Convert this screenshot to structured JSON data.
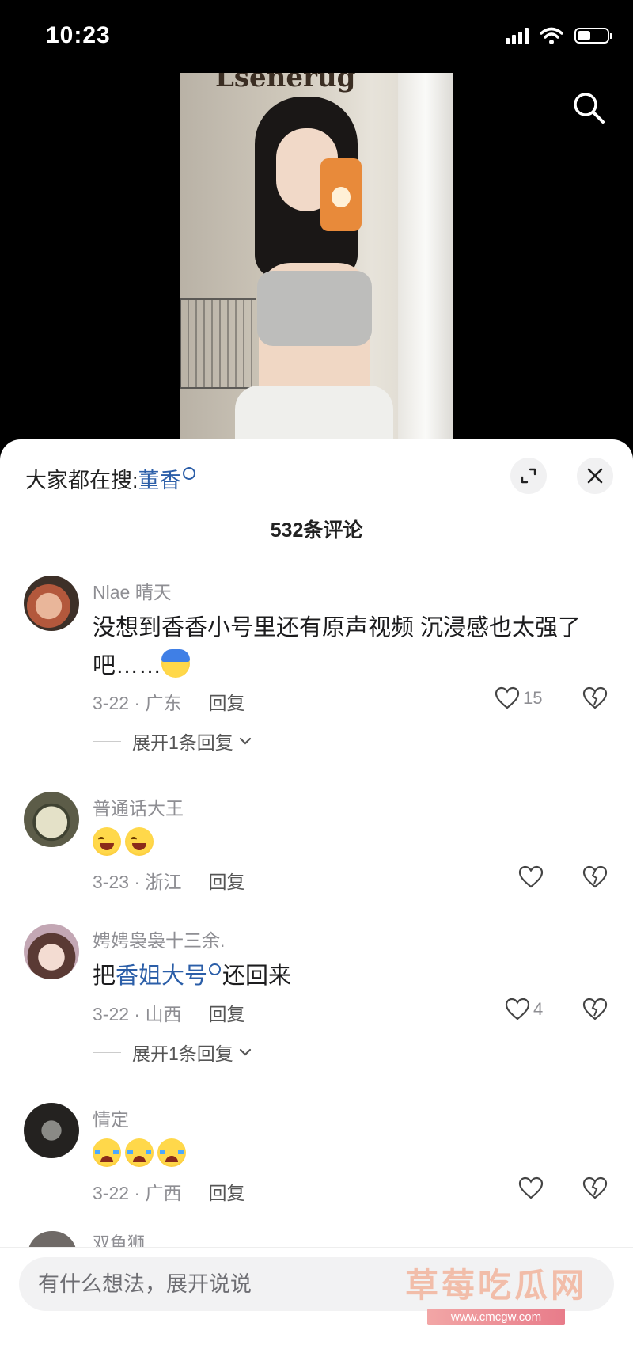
{
  "status_bar": {
    "time": "10:23"
  },
  "search": {
    "hot_label": "大家都在搜:",
    "hot_keyword": "董香"
  },
  "comments_header": {
    "count_text": "532条评论"
  },
  "comments": [
    {
      "username": "Nlae 晴天",
      "text": "没想到香香小号里还有原声视频 沉浸感也太强了吧……",
      "meta": "3-22 · 广东",
      "reply_label": "回复",
      "likes": "15",
      "expand_text": "展开1条回复"
    },
    {
      "username": "普通话大王",
      "meta": "3-23 · 浙江",
      "reply_label": "回复",
      "likes": ""
    },
    {
      "username": "娉娉袅袅十三余.",
      "text_before": "把",
      "text_link": "香姐大号",
      "text_after": "还回来",
      "meta": "3-22 · 山西",
      "reply_label": "回复",
      "likes": "4",
      "expand_text": "展开1条回复"
    },
    {
      "username": "情定",
      "meta": "3-22 · 广西",
      "reply_label": "回复",
      "likes": ""
    }
  ],
  "partial_comment": {
    "username": "双鱼狮"
  },
  "input": {
    "placeholder": "有什么想法，展开说说"
  },
  "watermark": {
    "title": "草莓吃瓜网",
    "url": "www.cmcgw.com"
  },
  "icons": [
    "search-icon",
    "expand-icon",
    "close-icon",
    "heart-icon",
    "broken-heart-icon",
    "chevron-down-icon",
    "signal-icon",
    "wifi-icon",
    "battery-icon"
  ],
  "colors": {
    "link": "#2b5ea8",
    "panel_bg": "#ffffff",
    "video_bg": "#000000"
  },
  "battery_level": 0.45
}
